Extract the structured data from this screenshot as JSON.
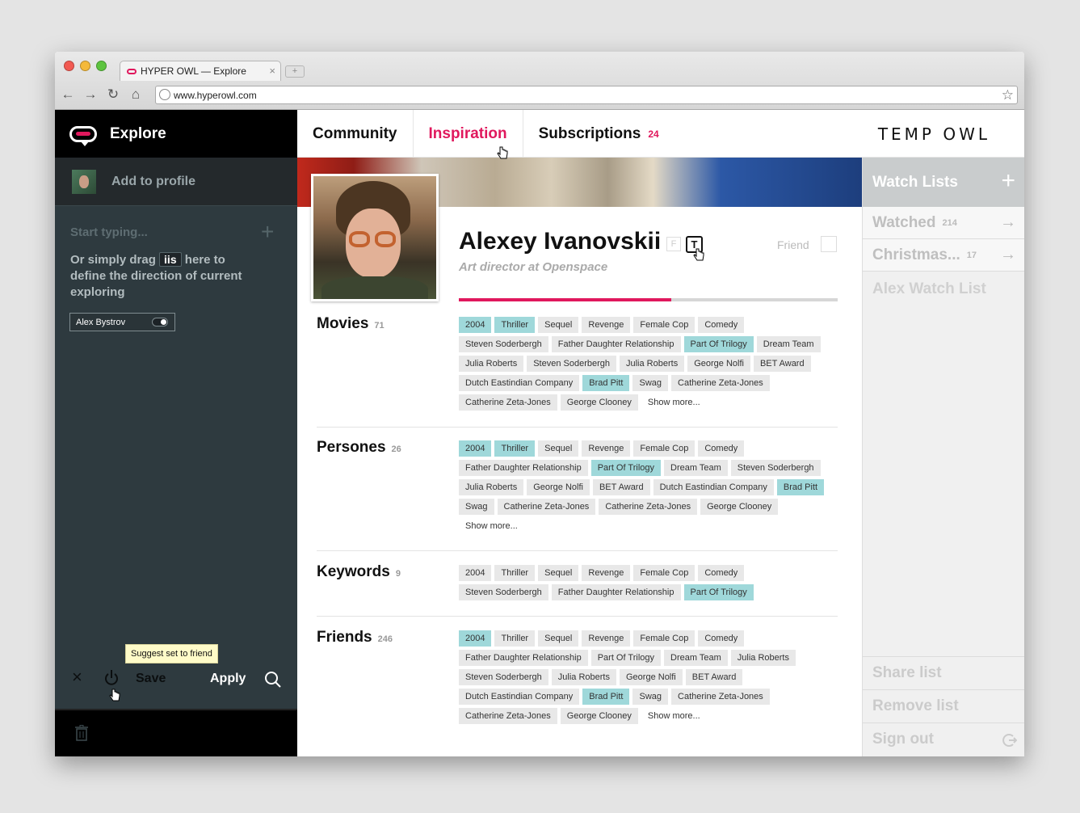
{
  "browser": {
    "tab_title": "HYPER OWL — Explore",
    "tab_close": "×",
    "new_tab": "+",
    "url": "www.hyperowl.com",
    "back_icon": "←",
    "forward_icon": "→",
    "reload_icon": "↻",
    "home_icon": "⌂",
    "star_icon": "☆"
  },
  "sidebar": {
    "title": "Explore",
    "add_to_profile": "Add to profile",
    "search_placeholder": "Start typing...",
    "plus": "+",
    "help_pre": "Or simply drag",
    "help_chip": "iis",
    "help_post": "here to define the direction of current exploring",
    "toggle_label": "Alex Bystrov",
    "close": "×",
    "save": "Save",
    "apply": "Apply",
    "tooltip": "Suggest set to friend"
  },
  "nav": {
    "items": [
      {
        "label": "Community",
        "count": ""
      },
      {
        "label": "Inspiration",
        "count": ""
      },
      {
        "label": "Subscriptions",
        "count": "24"
      }
    ],
    "active_index": 1,
    "brand": "TEMP OWL"
  },
  "profile": {
    "name": "Alexey Ivanovskii",
    "badge_f": "F",
    "badge_t": "T",
    "role": "Art director at Openspace",
    "friend_label": "Friend",
    "progress": 0.56
  },
  "sections": [
    {
      "title": "Movies",
      "count": "71",
      "tags": [
        {
          "t": "2004",
          "h": true
        },
        {
          "t": "Thriller",
          "h": true
        },
        {
          "t": "Sequel"
        },
        {
          "t": "Revenge"
        },
        {
          "t": "Female Cop"
        },
        {
          "t": "Comedy"
        },
        {
          "t": "Steven Soderbergh"
        },
        {
          "t": "Father Daughter Relationship"
        },
        {
          "t": "Part Of Trilogy",
          "h": true
        },
        {
          "t": "Dream Team"
        },
        {
          "t": "Julia Roberts"
        },
        {
          "t": "Steven Soderbergh"
        },
        {
          "t": "Julia Roberts"
        },
        {
          "t": "George Nolfi"
        },
        {
          "t": "BET Award"
        },
        {
          "t": "Dutch Eastindian Company"
        },
        {
          "t": "Brad Pitt",
          "h": true
        },
        {
          "t": "Swag"
        },
        {
          "t": "Catherine Zeta-Jones"
        },
        {
          "t": "Catherine Zeta-Jones"
        },
        {
          "t": "George Clooney"
        },
        {
          "t": "Show more...",
          "more": true
        }
      ]
    },
    {
      "title": "Persones",
      "count": "26",
      "tags": [
        {
          "t": "2004",
          "h": true
        },
        {
          "t": "Thriller",
          "h": true
        },
        {
          "t": "Sequel"
        },
        {
          "t": "Revenge"
        },
        {
          "t": "Female Cop"
        },
        {
          "t": "Comedy"
        },
        {
          "t": "Father Daughter Relationship"
        },
        {
          "t": "Part Of Trilogy",
          "h": true
        },
        {
          "t": "Dream Team"
        },
        {
          "t": "Steven Soderbergh"
        },
        {
          "t": "Julia Roberts"
        },
        {
          "t": "George Nolfi"
        },
        {
          "t": "BET Award"
        },
        {
          "t": "Dutch Eastindian Company"
        },
        {
          "t": "Brad Pitt",
          "h": true
        },
        {
          "t": "Swag"
        },
        {
          "t": "Catherine Zeta-Jones"
        },
        {
          "t": "Catherine Zeta-Jones"
        },
        {
          "t": "George Clooney"
        },
        {
          "t": "Show more...",
          "more": true
        }
      ]
    },
    {
      "title": "Keywords",
      "count": "9",
      "tags": [
        {
          "t": "2004"
        },
        {
          "t": "Thriller"
        },
        {
          "t": "Sequel"
        },
        {
          "t": "Revenge"
        },
        {
          "t": "Female Cop"
        },
        {
          "t": "Comedy"
        },
        {
          "t": "Steven Soderbergh"
        },
        {
          "t": "Father Daughter Relationship"
        },
        {
          "t": "Part Of Trilogy",
          "h": true
        }
      ]
    },
    {
      "title": "Friends",
      "count": "246",
      "tags": [
        {
          "t": "2004",
          "h": true
        },
        {
          "t": "Thriller"
        },
        {
          "t": "Sequel"
        },
        {
          "t": "Revenge"
        },
        {
          "t": "Female Cop"
        },
        {
          "t": "Comedy"
        },
        {
          "t": "Father Daughter Relationship"
        },
        {
          "t": "Part Of Trilogy"
        },
        {
          "t": "Dream Team"
        },
        {
          "t": "Julia Roberts"
        },
        {
          "t": "Steven Soderbergh"
        },
        {
          "t": "Julia Roberts"
        },
        {
          "t": "George Nolfi"
        },
        {
          "t": "BET Award"
        },
        {
          "t": "Dutch Eastindian Company"
        },
        {
          "t": "Brad Pitt",
          "h": true
        },
        {
          "t": "Swag"
        },
        {
          "t": "Catherine Zeta-Jones"
        },
        {
          "t": "Catherine Zeta-Jones"
        },
        {
          "t": "George Clooney"
        },
        {
          "t": "Show more...",
          "more": true
        }
      ]
    }
  ],
  "watchlists": {
    "header": "Watch Lists",
    "plus": "+",
    "items": [
      {
        "label": "Watched",
        "count": "214"
      },
      {
        "label": "Christmas...",
        "count": "17"
      }
    ],
    "plain": "Alex Watch List",
    "arrow": "→",
    "share": "Share list",
    "remove": "Remove list",
    "signout": "Sign out"
  },
  "colors": {
    "accent": "#e0185d",
    "tag_highlight": "#9fd8da",
    "sidebar": "#2e3a3f"
  }
}
